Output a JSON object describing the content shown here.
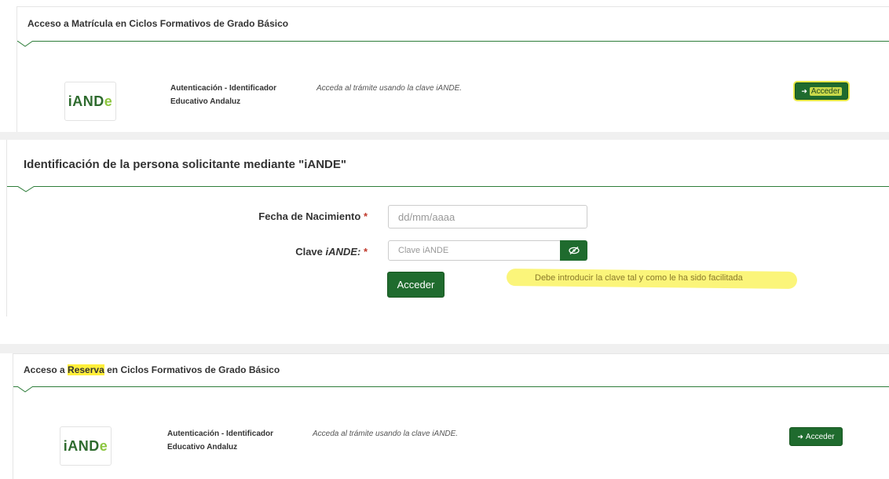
{
  "top_section": {
    "title": "Acceso a Matrícula en Ciclos Formativos de Grado Básico",
    "logo": "iANDe",
    "auth_name_line1": "Autenticación - Identificador",
    "auth_name_line2": "Educativo Andaluz",
    "auth_desc": "Acceda al trámite usando la clave iANDE.",
    "button_label": "Acceder",
    "button_icon": "sign-in-icon"
  },
  "id_section": {
    "title": "Identificación de la persona solicitante mediante \"iANDE\"",
    "birth_label": "Fecha de Nacimiento",
    "birth_placeholder": "dd/mm/aaaa",
    "clave_label_prefix": "Clave",
    "clave_label_em": "iANDE:",
    "clave_placeholder": "Clave iANDE",
    "required_mark": "*",
    "submit_label": "Acceder",
    "hint": "Debe introducir la clave tal y como le ha sido facilitada",
    "eye_icon": "eye-slash-icon"
  },
  "bottom_section": {
    "title_prefix": "Acceso a",
    "title_highlight": "Reserva",
    "title_suffix": "en Ciclos Formativos de Grado Básico",
    "logo": "iANDe",
    "auth_name_line1": "Autenticación - Identificador",
    "auth_name_line2": "Educativo Andaluz",
    "auth_desc": "Acceda al trámite usando la clave iANDE.",
    "button_label": "Acceder",
    "button_icon": "sign-in-icon"
  },
  "colors": {
    "accent_green": "#1f6b2e",
    "highlight_yellow": "#fbf57a",
    "required_red": "#c0392b"
  }
}
